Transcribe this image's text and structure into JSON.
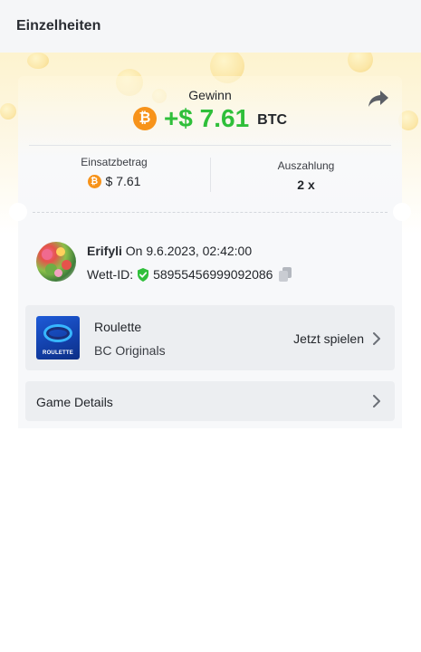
{
  "header": {
    "title": "Einzelheiten"
  },
  "win": {
    "label": "Gewinn",
    "coin_symbol": "₿",
    "amount": "+$ 7.61",
    "currency": "BTC",
    "share_icon": "share-arrow-icon"
  },
  "stats": {
    "bet": {
      "label": "Einsatzbetrag",
      "coin_symbol": "₿",
      "value": "$ 7.61"
    },
    "payout": {
      "label": "Auszahlung",
      "value": "2 x"
    }
  },
  "user": {
    "name": "Erifyli",
    "date_text": "On 9.6.2023, 02:42:00",
    "bet_id_label": "Wett-ID:",
    "bet_id": "58955456999092086",
    "verified_icon": "shield-check-icon",
    "copy_icon": "copy-icon"
  },
  "game": {
    "name": "Roulette",
    "provider": "BC Originals",
    "play_label": "Jetzt spielen",
    "thumb_label": "ROULETTE"
  },
  "details": {
    "label": "Game Details"
  },
  "colors": {
    "accent_green": "#2fbf3a",
    "btc_orange": "#f7931a",
    "row_bg": "#eceef1"
  }
}
